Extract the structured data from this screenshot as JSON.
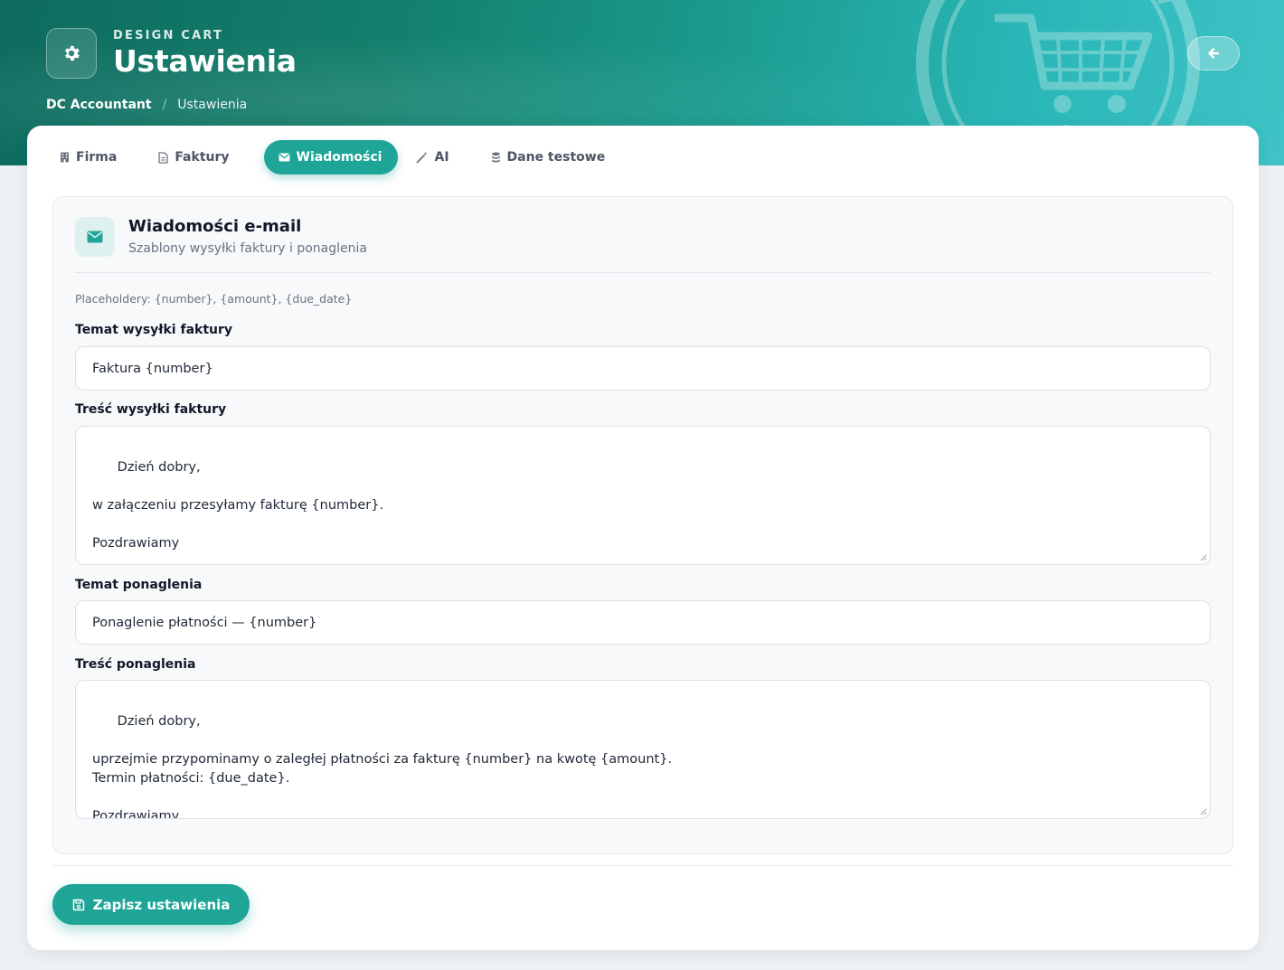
{
  "header": {
    "brand": "DESIGN CART",
    "title": "Ustawienia",
    "watermark_text": "Design Cart",
    "breadcrumb": {
      "root": "DC Accountant",
      "separator": "/",
      "current": "Ustawienia"
    }
  },
  "tabs": [
    {
      "label": "Firma",
      "icon": "building-icon",
      "active": false
    },
    {
      "label": "Faktury",
      "icon": "document-icon",
      "active": false
    },
    {
      "label": "Wiadomości",
      "icon": "envelope-icon",
      "active": true
    },
    {
      "label": "AI",
      "icon": "magic-wand-icon",
      "active": false
    },
    {
      "label": "Dane testowe",
      "icon": "database-icon",
      "active": false
    }
  ],
  "panel": {
    "title": "Wiadomości e-mail",
    "subtitle": "Szablony wysyłki faktury i ponaglenia",
    "placeholders_hint": "Placeholdery: {number}, {amount}, {due_date}",
    "fields": {
      "invoice_subject": {
        "label": "Temat wysyłki faktury",
        "value": "Faktura {number}"
      },
      "invoice_body": {
        "label": "Treść wysyłki faktury",
        "value": "Dzień dobry,\n\nw załączeniu przesyłamy fakturę {number}.\n\nPozdrawiamy"
      },
      "reminder_subject": {
        "label": "Temat ponaglenia",
        "value": "Ponaglenie płatności — {number}"
      },
      "reminder_body": {
        "label": "Treść ponaglenia",
        "value": "Dzień dobry,\n\nuprzejmie przypominamy o zaległej płatności za fakturę {number} na kwotę {amount}.\nTermin płatności: {due_date}.\n\nPozdrawiamy"
      }
    }
  },
  "actions": {
    "save_label": "Zapisz ustawienia"
  },
  "colors": {
    "accent": "#1fa598",
    "hero_start": "#0d6b5e",
    "hero_end": "#3fc3c6"
  }
}
